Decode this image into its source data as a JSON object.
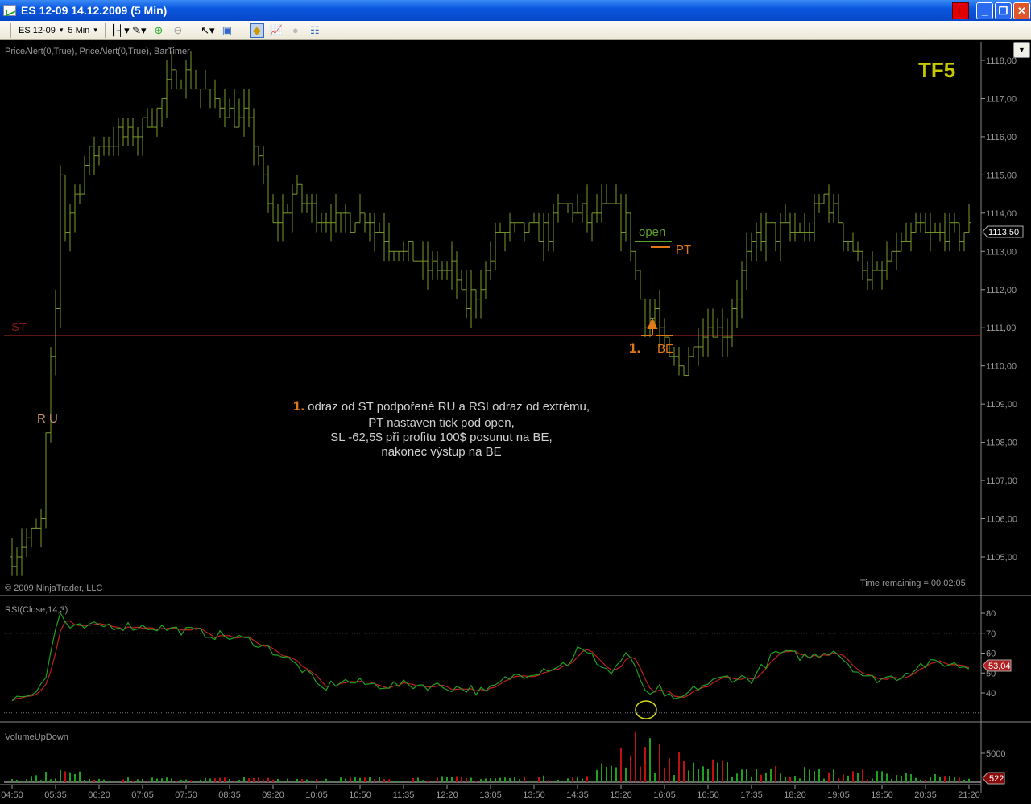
{
  "window": {
    "title": "ES 12-09  14.12.2009 (5 Min)",
    "l_badge": "L",
    "minimize": "_",
    "restore": "❐",
    "close": "✕"
  },
  "toolbar": {
    "instrument": "ES 12-09",
    "interval": "5 Min"
  },
  "indicators_label": "PriceAlert(0,True), PriceAlert(0,True), BarTimer",
  "tf_label": "TF5",
  "copyright": "© 2009 NinjaTrader, LLC",
  "time_remaining": "Time remaining = 00:02:05",
  "annotations": {
    "st": "ST",
    "ru": "R U",
    "open": "open",
    "pt": "PT",
    "be": "BE",
    "num": "1.",
    "note_num": "1.",
    "note_lines": [
      "odraz od ST podpořené RU a RSI odraz od extrému,",
      "PT nastaven tick pod open,",
      "SL -62,5$ při profitu 100$ posunut na BE,",
      "nakonec výstup na BE"
    ]
  },
  "colors": {
    "bars": "#7a9a2a",
    "st_line": "#7a1a1a",
    "annot": "#e07818",
    "open": "#5aa02a",
    "tf": "#c8c800",
    "rsi": "#1fa01f",
    "rsi_avg": "#c02020",
    "vol_up": "#1fa01f",
    "vol_down": "#c01010"
  },
  "chart_data": [
    {
      "type": "line",
      "title": "ES 12-09 5 Min price bars",
      "ylim": [
        1104.5,
        1118.5
      ],
      "y_ticks": [
        "1105,00",
        "1106,00",
        "1107,00",
        "1108,00",
        "1109,00",
        "1110,00",
        "1111,00",
        "1112,00",
        "1113,00",
        "1114,00",
        "1115,00",
        "1116,00",
        "1117,00",
        "1118,00"
      ],
      "last_price": "1113,50",
      "st_level": 1110.8,
      "dotted_level": 1114.45,
      "open_level": 1113.3,
      "pt_level": 1113.1,
      "be_level": 1110.8,
      "x_ticks": [
        "04:50",
        "05:35",
        "06:20",
        "07:05",
        "07:50",
        "08:35",
        "09:20",
        "10:05",
        "10:50",
        "11:35",
        "12:20",
        "13:05",
        "13:50",
        "14:35",
        "15:20",
        "16:05",
        "16:50",
        "17:35",
        "18:20",
        "19:05",
        "19:50",
        "20:35",
        "21:20"
      ],
      "bar_count": 199,
      "close_keypoints": [
        [
          0,
          1105.0
        ],
        [
          4,
          1105.5
        ],
        [
          6,
          1106
        ],
        [
          7,
          1108
        ],
        [
          8,
          1110
        ],
        [
          9,
          1111.5
        ],
        [
          10,
          1115
        ],
        [
          11,
          1113.5
        ],
        [
          13,
          1114.5
        ],
        [
          16,
          1115.5
        ],
        [
          19,
          1115.8
        ],
        [
          24,
          1116
        ],
        [
          29,
          1116.5
        ],
        [
          33,
          1117.5
        ],
        [
          36,
          1117.5
        ],
        [
          41,
          1117
        ],
        [
          46,
          1116.5
        ],
        [
          48,
          1116.5
        ],
        [
          51,
          1115.5
        ],
        [
          54,
          1113.5
        ],
        [
          58,
          1114.5
        ],
        [
          63,
          1114
        ],
        [
          68,
          1113.8
        ],
        [
          73,
          1114
        ],
        [
          76,
          1113.5
        ],
        [
          81,
          1113
        ],
        [
          86,
          1112.5
        ],
        [
          91,
          1112.5
        ],
        [
          94,
          1111.5
        ],
        [
          98,
          1112.5
        ],
        [
          101,
          1113.5
        ],
        [
          106,
          1113.5
        ],
        [
          111,
          1113.5
        ],
        [
          114,
          1114.3
        ],
        [
          119,
          1113.8
        ],
        [
          124,
          1114
        ],
        [
          127,
          1113.8
        ],
        [
          129,
          1112.5
        ],
        [
          131,
          1111.2
        ],
        [
          133,
          1111.5
        ],
        [
          136,
          1110
        ],
        [
          139,
          1110
        ],
        [
          143,
          1111
        ],
        [
          148,
          1111
        ],
        [
          151,
          1112.5
        ],
        [
          155,
          1113.5
        ],
        [
          161,
          1113.5
        ],
        [
          164,
          1113.5
        ],
        [
          168,
          1114.5
        ],
        [
          171,
          1113.8
        ],
        [
          174,
          1113
        ],
        [
          179,
          1112.2
        ],
        [
          183,
          1113
        ],
        [
          188,
          1113.5
        ],
        [
          193,
          1113.5
        ],
        [
          198,
          1113.5
        ]
      ]
    },
    {
      "type": "line",
      "title": "RSI(Close,14,3)",
      "ylim": [
        25,
        85
      ],
      "y_ticks": [
        "40",
        "50",
        "60",
        "70",
        "80"
      ],
      "levels": [
        70,
        30
      ],
      "last_value": "53,04",
      "keypoints": [
        [
          0,
          37
        ],
        [
          4,
          40
        ],
        [
          7,
          48
        ],
        [
          9,
          72
        ],
        [
          10,
          80
        ],
        [
          12,
          72
        ],
        [
          20,
          74
        ],
        [
          30,
          73
        ],
        [
          40,
          70
        ],
        [
          50,
          66
        ],
        [
          55,
          60
        ],
        [
          60,
          52
        ],
        [
          64,
          42
        ],
        [
          68,
          46
        ],
        [
          75,
          44
        ],
        [
          85,
          44
        ],
        [
          95,
          42
        ],
        [
          98,
          40
        ],
        [
          103,
          48
        ],
        [
          115,
          55
        ],
        [
          117,
          62
        ],
        [
          120,
          58
        ],
        [
          124,
          50
        ],
        [
          127,
          60
        ],
        [
          130,
          47
        ],
        [
          132,
          37
        ],
        [
          134,
          42
        ],
        [
          137,
          35
        ],
        [
          142,
          43
        ],
        [
          148,
          48
        ],
        [
          153,
          47
        ],
        [
          158,
          60
        ],
        [
          165,
          58
        ],
        [
          170,
          62
        ],
        [
          173,
          55
        ],
        [
          177,
          47
        ],
        [
          183,
          48
        ],
        [
          188,
          54
        ],
        [
          193,
          55
        ],
        [
          198,
          53
        ]
      ]
    },
    {
      "type": "bar",
      "title": "VolumeUpDown",
      "ylim": [
        0,
        10000
      ],
      "y_ticks": [
        "5000"
      ],
      "last_value": "522",
      "profile_keypoints": [
        [
          0,
          800
        ],
        [
          8,
          1500
        ],
        [
          10,
          2000
        ],
        [
          20,
          600
        ],
        [
          60,
          700
        ],
        [
          120,
          900
        ],
        [
          129,
          9000
        ],
        [
          132,
          6000
        ],
        [
          136,
          4500
        ],
        [
          145,
          3000
        ],
        [
          155,
          2500
        ],
        [
          170,
          1800
        ],
        [
          185,
          1500
        ],
        [
          198,
          600
        ]
      ]
    }
  ]
}
